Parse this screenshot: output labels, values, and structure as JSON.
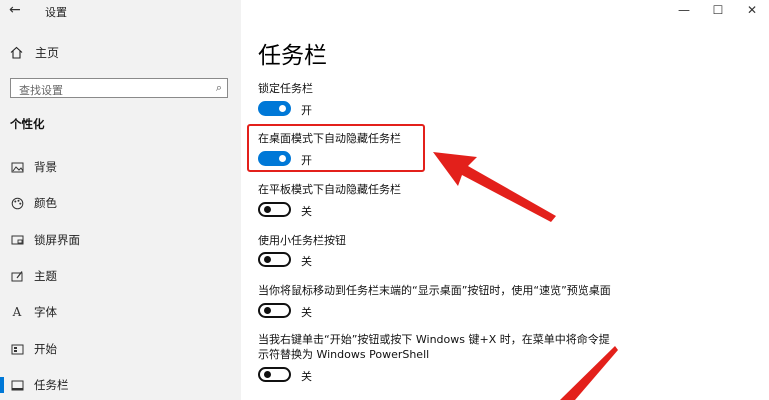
{
  "titlebar": {
    "back_icon": "←",
    "title": "设置",
    "minimize": "—",
    "maximize": "☐",
    "close": "✕"
  },
  "sidebar": {
    "home_label": "主页",
    "search_placeholder": "查找设置",
    "section_title": "个性化",
    "items": [
      {
        "label": "背景",
        "icon": "image-icon"
      },
      {
        "label": "颜色",
        "icon": "palette-icon"
      },
      {
        "label": "锁屏界面",
        "icon": "lockscreen-icon"
      },
      {
        "label": "主题",
        "icon": "theme-icon"
      },
      {
        "label": "字体",
        "icon": "font-icon"
      },
      {
        "label": "开始",
        "icon": "start-icon"
      },
      {
        "label": "任务栏",
        "icon": "taskbar-icon",
        "active": true
      }
    ]
  },
  "main": {
    "title": "任务栏",
    "settings": [
      {
        "label": "锁定任务栏",
        "state": "开",
        "on": true
      },
      {
        "label": "在桌面模式下自动隐藏任务栏",
        "state": "开",
        "on": true
      },
      {
        "label": "在平板模式下自动隐藏任务栏",
        "state": "关",
        "on": false
      },
      {
        "label": "使用小任务栏按钮",
        "state": "关",
        "on": false
      },
      {
        "label": "当你将鼠标移动到任务栏末端的“显示桌面”按钮时，使用“速览”预览桌面",
        "state": "关",
        "on": false
      },
      {
        "label_line1": "当我右键单击“开始”按钮或按下 Windows 键+X 时，在菜单中将命令提",
        "label_line2": "示符替换为 Windows PowerShell",
        "state": "关",
        "on": false
      }
    ]
  },
  "colors": {
    "accent": "#0078d7",
    "annotation": "#e3201b",
    "sidebar_bg": "#f2f2f2"
  }
}
